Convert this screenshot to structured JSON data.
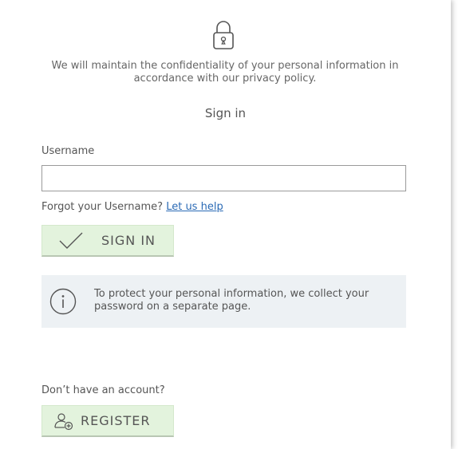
{
  "security": {
    "icon": "lock-icon",
    "notice": "We will maintain the confidentiality of your personal information in accordance with our privacy policy."
  },
  "form": {
    "title": "Sign in",
    "username_label": "Username",
    "username_value": "",
    "forgot_text": "Forgot your Username?",
    "forgot_link": "Let us help",
    "sign_in_icon": "checkmark-icon",
    "sign_in_label": "SIGN IN"
  },
  "info": {
    "icon": "info-icon",
    "text": "To protect your personal information, we collect your password on a separate page."
  },
  "register": {
    "prompt": "Don’t have an account?",
    "icon": "add-user-icon",
    "label": "REGISTER"
  },
  "colors": {
    "button_bg": "#e3f3dd",
    "info_bg": "#edf1f4",
    "link": "#2a6ab5"
  }
}
